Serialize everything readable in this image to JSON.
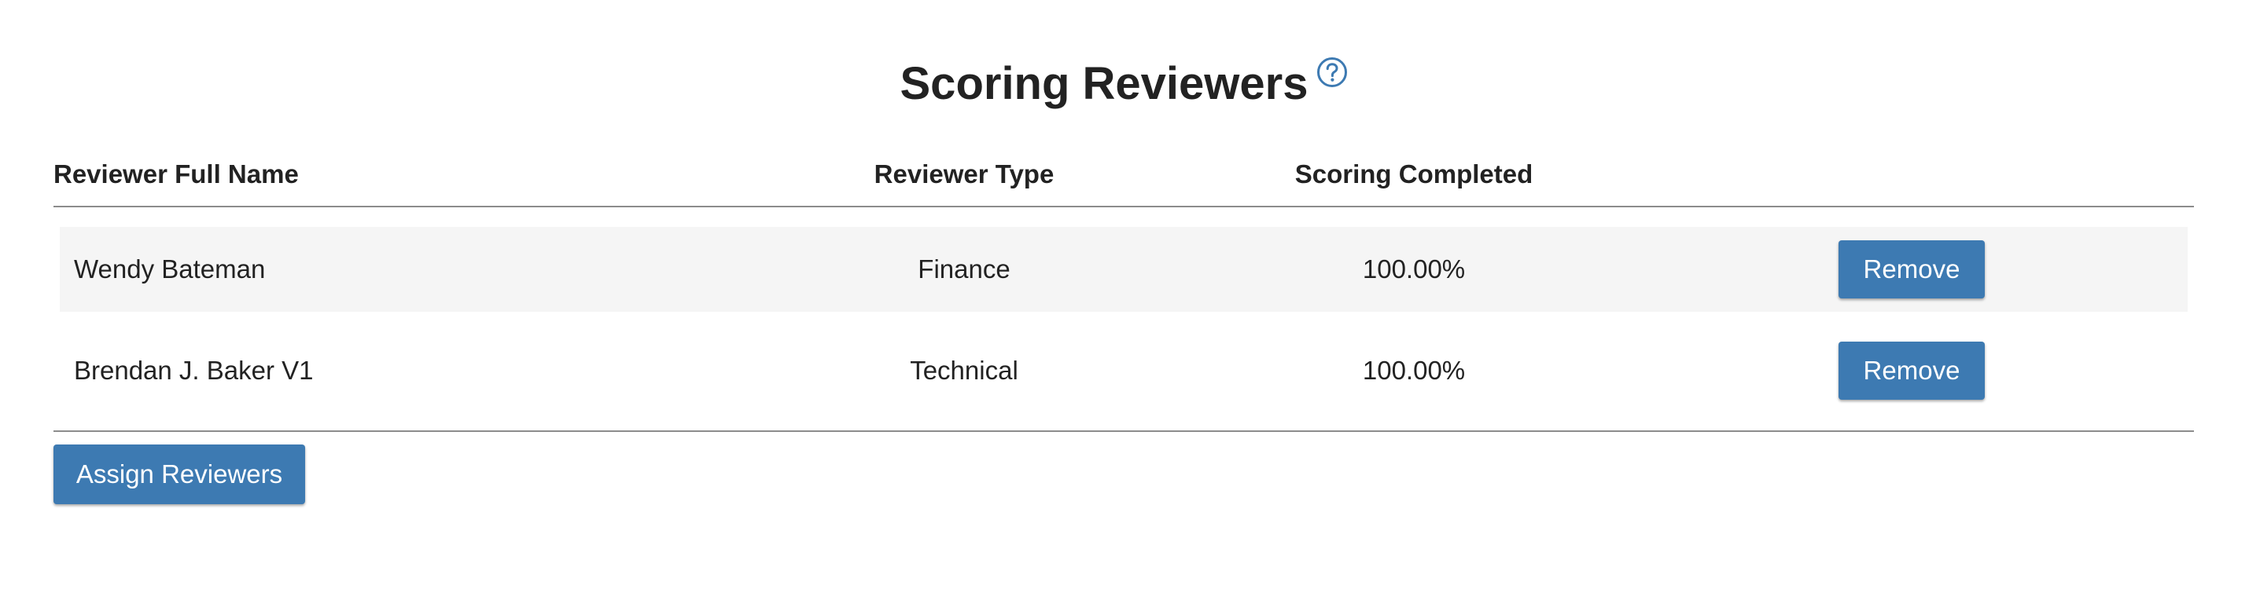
{
  "page": {
    "title": "Scoring Reviewers"
  },
  "table": {
    "headers": {
      "name": "Reviewer Full Name",
      "type": "Reviewer Type",
      "score": "Scoring Completed"
    },
    "rows": [
      {
        "name": "Wendy Bateman",
        "type": "Finance",
        "score": "100.00%",
        "action": "Remove"
      },
      {
        "name": "Brendan J. Baker V1",
        "type": "Technical",
        "score": "100.00%",
        "action": "Remove"
      }
    ]
  },
  "footer": {
    "assign_label": "Assign Reviewers"
  },
  "icons": {
    "help": "question-circle-icon"
  },
  "colors": {
    "accent": "#3d7ab2",
    "row_stripe": "#f5f5f5",
    "text": "#222222"
  }
}
